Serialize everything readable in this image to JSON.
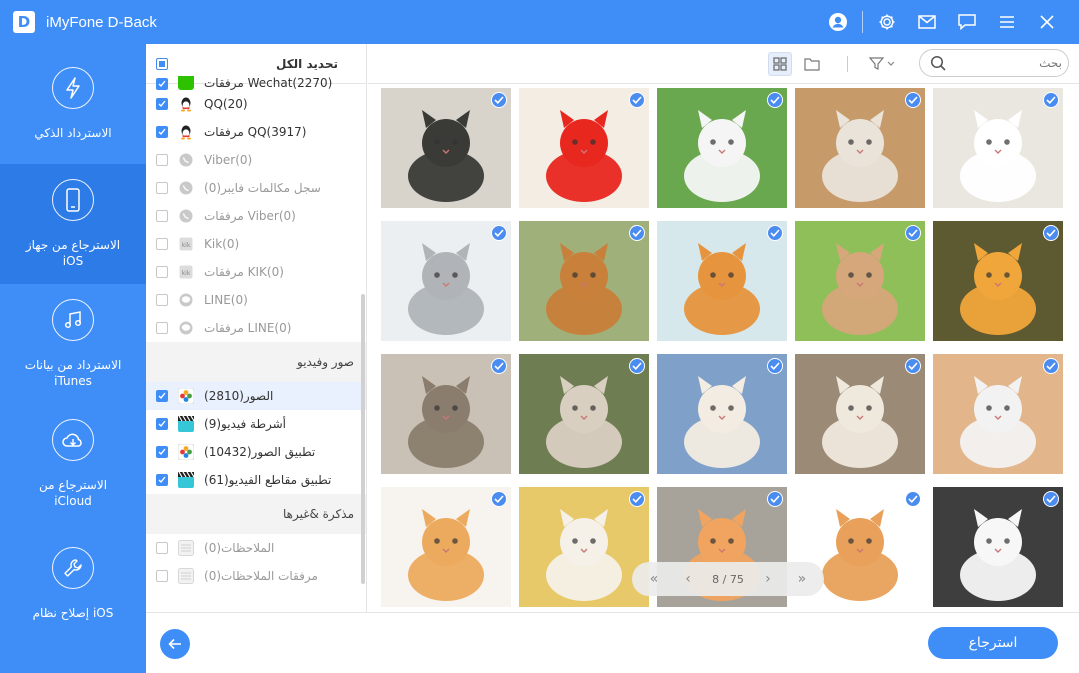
{
  "app": {
    "title": "iMyFone D-Back",
    "logo_letter": "D"
  },
  "titlebar_icons": [
    "user-icon",
    "gear-icon",
    "mail-icon",
    "chat-icon",
    "menu-icon",
    "close-icon"
  ],
  "nav": [
    {
      "label": "الاسترداد الذكي",
      "icon": "lightning-icon",
      "active": false
    },
    {
      "label": "الاسترجاع من جهاز iOS",
      "icon": "phone-icon",
      "active": true
    },
    {
      "label": "الاسترداد من بيانات iTunes",
      "icon": "music-icon",
      "active": false
    },
    {
      "label": "الاسترجاع من iCloud",
      "icon": "cloud-icon",
      "active": false
    },
    {
      "label": "إصلاح نظام iOS",
      "icon": "wrench-icon",
      "active": false
    }
  ],
  "list": {
    "select_all_label": "تحديد الكل",
    "top_partial": "مرفقات Wechat(2270)",
    "rows_a": [
      {
        "label": "QQ(20)",
        "checked": true,
        "icon": "qq-icon",
        "dim": false
      },
      {
        "label": "مرفقات QQ(3917)",
        "checked": true,
        "icon": "qq-icon",
        "dim": false
      },
      {
        "label": "Viber(0)",
        "checked": false,
        "icon": "viber-icon",
        "dim": true
      },
      {
        "label": "سجل مكالمات فايبر(0)",
        "checked": false,
        "icon": "viber-icon",
        "dim": true
      },
      {
        "label": "مرفقات Viber(0)",
        "checked": false,
        "icon": "viber-icon",
        "dim": true
      },
      {
        "label": "Kik(0)",
        "checked": false,
        "icon": "kik-icon",
        "dim": true
      },
      {
        "label": "مرفقات KIK(0)",
        "checked": false,
        "icon": "kik-icon",
        "dim": true
      },
      {
        "label": "LINE(0)",
        "checked": false,
        "icon": "line-icon",
        "dim": true
      },
      {
        "label": "مرفقات LINE(0)",
        "checked": false,
        "icon": "line-icon",
        "dim": true
      }
    ],
    "section_media": "صور وفيديو",
    "rows_b": [
      {
        "label": "الصور(2810)",
        "checked": true,
        "icon": "photos-icon",
        "dim": false,
        "selected": true
      },
      {
        "label": "أشرطة فيديو(9)",
        "checked": true,
        "icon": "video-icon",
        "dim": false
      },
      {
        "label": "تطبيق الصور(10432)",
        "checked": true,
        "icon": "photos-icon",
        "dim": false
      },
      {
        "label": "تطبيق مقاطع الفيديو(61)",
        "checked": true,
        "icon": "video-icon",
        "dim": false
      }
    ],
    "section_memo": "مذكرة &غيرها",
    "rows_c": [
      {
        "label": "الملاحظات(0)",
        "checked": false,
        "icon": "notes-icon",
        "dim": true
      },
      {
        "label": "مرفقات الملاحظات(0)",
        "checked": false,
        "icon": "notes-icon",
        "dim": true
      }
    ]
  },
  "toolbar": {
    "search_placeholder": "بحث"
  },
  "pager": {
    "label": "8 / 75"
  },
  "footer": {
    "recover_label": "استرجاع"
  },
  "colors": {
    "accent": "#3f8ef7",
    "nav_active": "#2d7be6"
  }
}
